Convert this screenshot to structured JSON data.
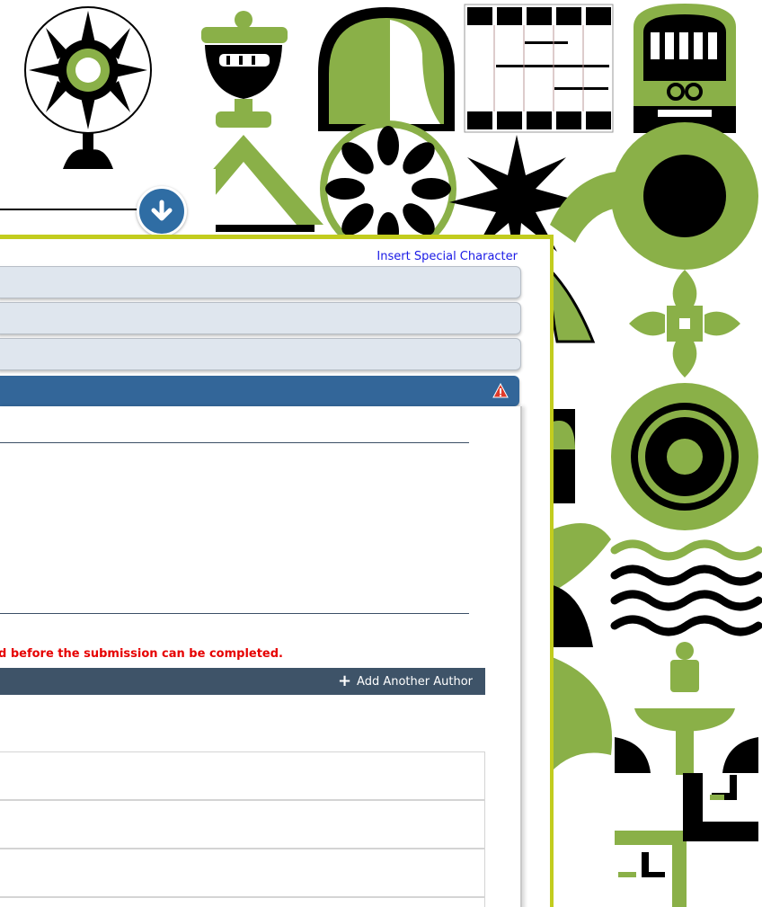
{
  "toolbar": {
    "special_char_label": "Insert Special Character"
  },
  "form": {
    "add_author_label": "Add Another Author",
    "error_message": "d before the submission can be completed."
  },
  "colors": {
    "panel_border": "#c2cc1e",
    "active_section": "#336699",
    "author_bar": "#3e5368",
    "error_text": "#e60000",
    "pattern_green": "#8ab048",
    "scroll_button": "#2f6da4"
  },
  "icons": {
    "scroll_down": "arrow-down-circle-icon",
    "warning": "warning-triangle-icon",
    "add": "plus-icon"
  }
}
